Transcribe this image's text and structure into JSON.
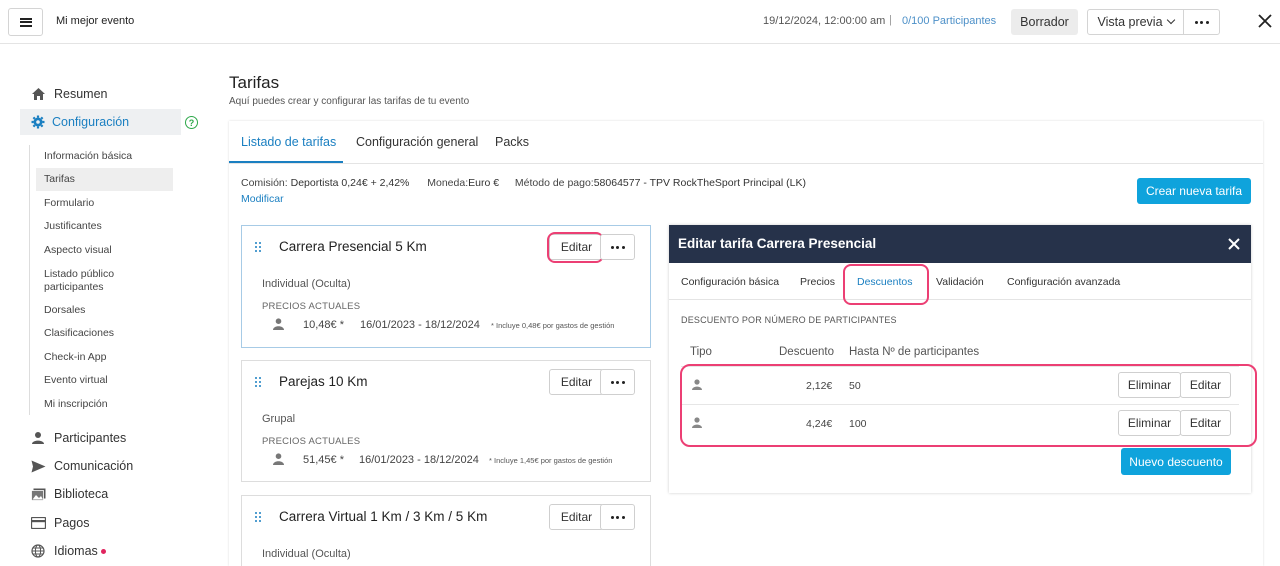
{
  "header": {
    "event_name": "Mi mejor evento",
    "date": "19/12/2024, 12:00:00 am",
    "separator": "|",
    "participants": "0/100 Participantes",
    "status": "Borrador",
    "preview_label": "Vista previa"
  },
  "sidebar": {
    "summary": "Resumen",
    "config": "Configuración",
    "sub_items": [
      "Información básica",
      "Tarifas",
      "Formulario",
      "Justificantes",
      "Aspecto visual",
      "Listado público participantes",
      "Dorsales",
      "Clasificaciones",
      "Check-in App",
      "Evento virtual",
      "Mi inscripción"
    ],
    "participants": "Participantes",
    "communication": "Comunicación",
    "library": "Biblioteca",
    "payments": "Pagos",
    "languages": "Idiomas"
  },
  "page": {
    "title": "Tarifas",
    "subtitle": "Aquí puedes crear y configurar las tarifas de tu evento",
    "tabs": [
      "Listado de tarifas",
      "Configuración general",
      "Packs"
    ],
    "commission_label": "Comisión:",
    "commission_value": "Deportista 0,24€ + 2,42%",
    "currency_label": "Moneda:",
    "currency_value": "Euro €",
    "payment_label": "Método de pago:",
    "payment_value": "58064577 - TPV RockTheSport Principal (LK)",
    "modify": "Modificar",
    "create_button": "Crear nueva tarifa"
  },
  "rates": [
    {
      "title": "Carrera Presencial 5 Km",
      "type": "Individual (Oculta)",
      "prices_label": "PRECIOS ACTUALES",
      "price": "10,48€ *",
      "dates": "16/01/2023 - 18/12/2024",
      "note": "* Incluye 0,48€ por gastos de gestión",
      "edit": "Editar"
    },
    {
      "title": "Parejas 10 Km",
      "type": "Grupal",
      "prices_label": "PRECIOS ACTUALES",
      "price": "51,45€ *",
      "dates": "16/01/2023 - 18/12/2024",
      "note": "* Incluye 1,45€ por gastos de gestión",
      "edit": "Editar"
    },
    {
      "title": "Carrera Virtual 1 Km / 3 Km / 5 Km",
      "type": "Individual (Oculta)",
      "edit": "Editar"
    }
  ],
  "edit_panel": {
    "title": "Editar tarifa Carrera Presencial",
    "tabs": [
      "Configuración básica",
      "Precios",
      "Descuentos",
      "Validación",
      "Configuración avanzada"
    ],
    "section": "DESCUENTO POR NÚMERO DE PARTICIPANTES",
    "columns": [
      "Tipo",
      "Descuento",
      "Hasta Nº de participantes"
    ],
    "rows": [
      {
        "discount": "2,12€",
        "limit": "50"
      },
      {
        "discount": "4,24€",
        "limit": "100"
      }
    ],
    "delete": "Eliminar",
    "edit": "Editar",
    "new_discount": "Nuevo descuento"
  },
  "colors": {
    "accent": "#1a7fc1",
    "primary_button": "#0fa3dc",
    "highlight": "#ec3f74",
    "panel_header": "#26324a"
  }
}
